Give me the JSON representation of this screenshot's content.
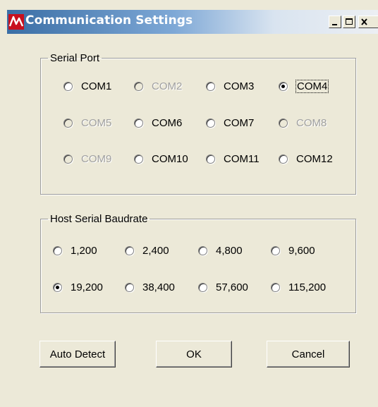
{
  "window": {
    "title": "Communication Settings",
    "icon": "app-logo-icon",
    "controls": [
      "minimize-icon",
      "maximize-icon",
      "close-icon"
    ]
  },
  "serial_port": {
    "legend": "Serial Port",
    "selected": "COM4",
    "options": [
      {
        "label": "COM1",
        "enabled": true
      },
      {
        "label": "COM2",
        "enabled": false
      },
      {
        "label": "COM3",
        "enabled": true
      },
      {
        "label": "COM4",
        "enabled": true
      },
      {
        "label": "COM5",
        "enabled": false
      },
      {
        "label": "COM6",
        "enabled": true
      },
      {
        "label": "COM7",
        "enabled": true
      },
      {
        "label": "COM8",
        "enabled": false
      },
      {
        "label": "COM9",
        "enabled": false
      },
      {
        "label": "COM10",
        "enabled": true
      },
      {
        "label": "COM11",
        "enabled": true
      },
      {
        "label": "COM12",
        "enabled": true
      }
    ]
  },
  "baudrate": {
    "legend": "Host Serial Baudrate",
    "selected": "19,200",
    "options": [
      "1,200",
      "2,400",
      "4,800",
      "9,600",
      "19,200",
      "38,400",
      "57,600",
      "115,200"
    ]
  },
  "buttons": {
    "auto_detect": "Auto Detect",
    "ok": "OK",
    "cancel": "Cancel"
  }
}
